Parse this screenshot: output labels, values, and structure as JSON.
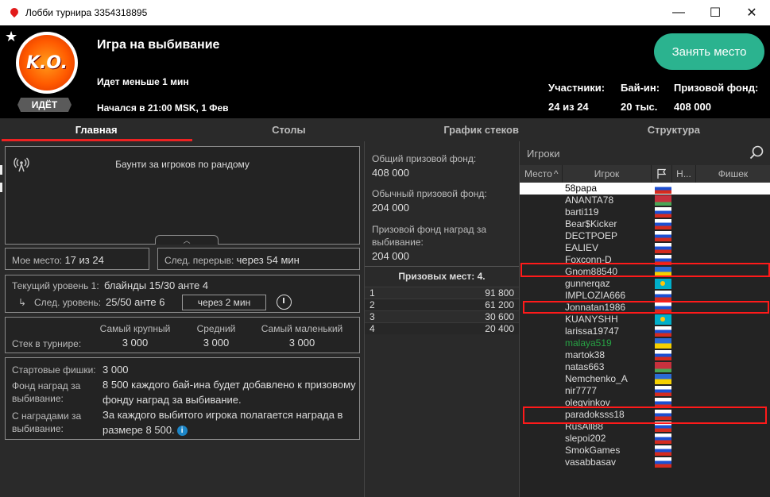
{
  "window": {
    "title": "Лобби турнира 3354318895",
    "controls": {
      "minimize": "—",
      "maximize": "☐",
      "close": "✕"
    }
  },
  "header": {
    "star": "★",
    "logo_text": "K.O.",
    "status_badge": "ИДЁТ",
    "tournament_name": "Игра на выбивание",
    "time_status": "Идет меньше 1 мин",
    "start_time": "Начался в 21:00 MSK, 1 Фев",
    "take_seat_label": "Занять место",
    "stats": {
      "players_label": "Участники:",
      "players_value": "24 из 24",
      "buyin_label": "Бай-ин:",
      "buyin_value": "20 тыс.",
      "prize_label": "Призовой фонд:",
      "prize_value": "408 000"
    }
  },
  "tabs": [
    {
      "label": "Главная",
      "active": true
    },
    {
      "label": "Столы",
      "active": false
    },
    {
      "label": "График стеков",
      "active": false
    },
    {
      "label": "Структура",
      "active": false
    }
  ],
  "main": {
    "broadcast_text": "Баунти за игроков по рандому",
    "my_place_label": "Мое место:",
    "my_place_value": "17 из 24",
    "next_break_label": "След. перерыв:",
    "next_break_value": "через 54 мин",
    "current_level_label": "Текущий уровень 1:",
    "current_level_value": "блайнды 15/30 анте 4",
    "next_level_label": "След. уровень:",
    "next_level_value": "25/50 анте 6",
    "next_level_time": "через 2 мин",
    "stack_headers": {
      "largest": "Самый крупный",
      "average": "Средний",
      "smallest": "Самый маленький"
    },
    "stack_label": "Стек в турнире:",
    "stack_values": {
      "largest": "3 000",
      "average": "3 000",
      "smallest": "3 000"
    },
    "starting_chips_label": "Стартовые фишки:",
    "starting_chips_value": "3 000",
    "ko_fund_label": "Фонд наград за выбивание:",
    "ko_fund_value": "8 500 каждого бай-ина будет добавлено к призовому фонду наград за выбивание.",
    "ko_rewards_label": "С наградами за выбивание:",
    "ko_rewards_value": "За каждого выбитого игрока полагается награда в размере 8 500.",
    "info_icon": "i"
  },
  "prizes": {
    "total_label": "Общий призовой фонд:",
    "total_value": "408 000",
    "regular_label": "Обычный призовой фонд:",
    "regular_value": "204 000",
    "ko_label": "Призовой фонд наград за выбивание:",
    "ko_value": "204 000",
    "places_header": "Призовых мест: 4.",
    "places": [
      {
        "place": "1",
        "amount": "91 800"
      },
      {
        "place": "2",
        "amount": "61 200"
      },
      {
        "place": "3",
        "amount": "30 600"
      },
      {
        "place": "4",
        "amount": "20 400"
      }
    ]
  },
  "players": {
    "search_label": "Игроки",
    "columns": {
      "place": "Место",
      "player": "Игрок",
      "n": "Н...",
      "chips": "Фишек"
    },
    "list": [
      {
        "name": "58papa",
        "flag": "ru"
      },
      {
        "name": "ANANTA78",
        "flag": "by"
      },
      {
        "name": "barti119",
        "flag": "ru"
      },
      {
        "name": "Bear$Kicker",
        "flag": "ru"
      },
      {
        "name": "DECTPOEP",
        "flag": "ru"
      },
      {
        "name": "EALIEV",
        "flag": "ru"
      },
      {
        "name": "Foxconn-D",
        "flag": "ru"
      },
      {
        "name": "Gnom88540",
        "flag": "ua"
      },
      {
        "name": "gunnerqaz",
        "flag": "kz"
      },
      {
        "name": "IMPLOZIA666",
        "flag": "ru"
      },
      {
        "name": "Jonnatan1986",
        "flag": "ru"
      },
      {
        "name": "KUANYSHH",
        "flag": "kz"
      },
      {
        "name": "larissa19747",
        "flag": "ru"
      },
      {
        "name": "malaya519",
        "flag": "ua"
      },
      {
        "name": "martok38",
        "flag": "ru"
      },
      {
        "name": "natas663",
        "flag": "by"
      },
      {
        "name": "Nemchenko_A",
        "flag": "ua"
      },
      {
        "name": "nir7777",
        "flag": "ru"
      },
      {
        "name": "olegvinkov",
        "flag": "ru"
      },
      {
        "name": "paradoksss18",
        "flag": "ru"
      },
      {
        "name": "RusAll88",
        "flag": "ru"
      },
      {
        "name": "slepoi202",
        "flag": "ru"
      },
      {
        "name": "SmokGames",
        "flag": "ru"
      },
      {
        "name": "vasabbasav",
        "flag": "ru"
      }
    ]
  },
  "colors": {
    "accent": "#2bb38f",
    "tab_active": "#e22222",
    "highlight": "#ff1a1a",
    "green_name": "#27a244"
  }
}
